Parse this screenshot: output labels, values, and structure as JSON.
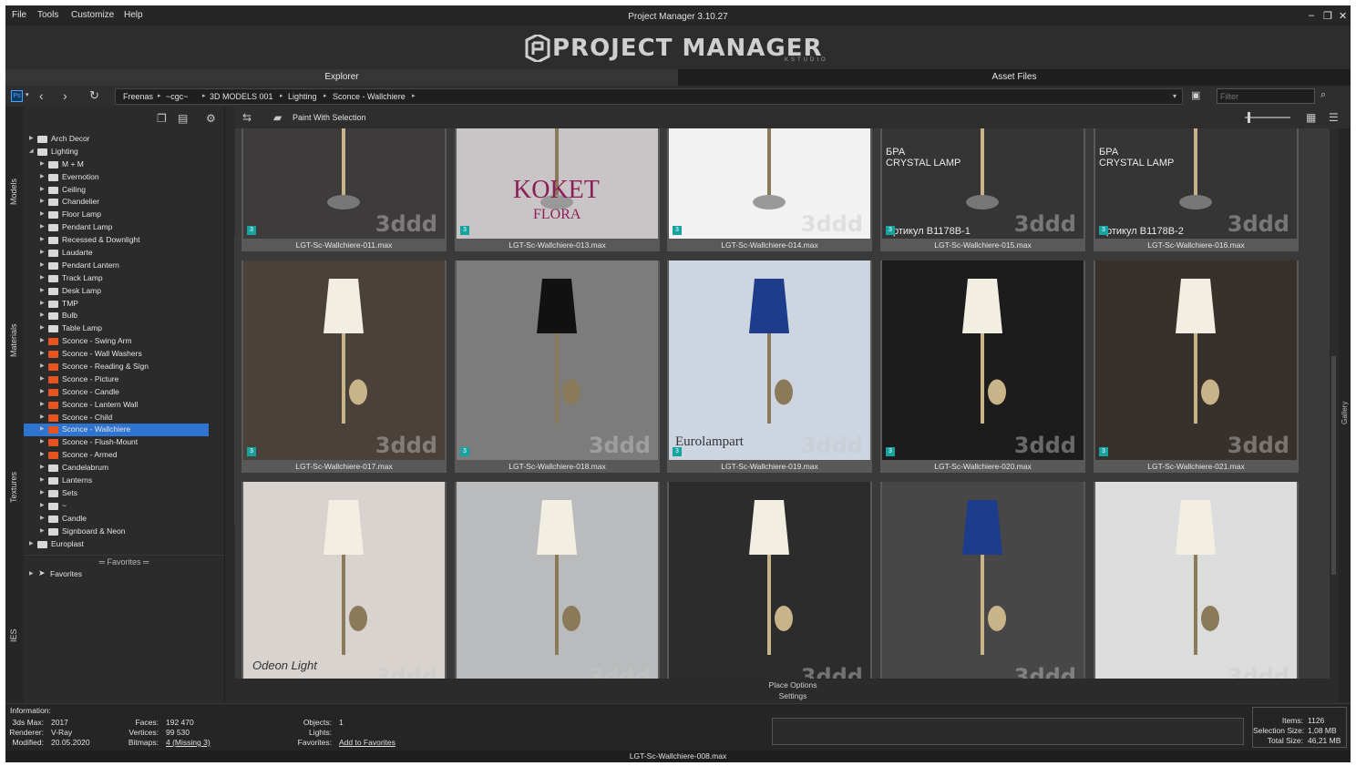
{
  "menu": [
    "File",
    "Tools",
    "Customize",
    "Help"
  ],
  "app_title": "Project Manager 3.10.27",
  "logo": {
    "text": "PROJECT MANAGER",
    "sub": "KSTUDIO"
  },
  "tabs": {
    "explorer": "Explorer",
    "assets": "Asset Files"
  },
  "breadcrumb": [
    "Freenas",
    "~cgc~",
    "3D MODELS 001",
    "Lighting",
    "Sconce - Wallchiere"
  ],
  "filter_placeholder": "Filter",
  "side_tabs": [
    "Models",
    "Materials",
    "Textures",
    "IES"
  ],
  "toolbar": {
    "paint_label": "Paint With Selection"
  },
  "tree": [
    {
      "label": "Arch Decor",
      "level": 0,
      "color": "gray"
    },
    {
      "label": "Lighting",
      "level": 0,
      "color": "gray",
      "open": true
    },
    {
      "label": "M + M",
      "level": 1,
      "color": "gray"
    },
    {
      "label": "Evernotion",
      "level": 1,
      "color": "gray"
    },
    {
      "label": "Ceiling",
      "level": 1,
      "color": "gray"
    },
    {
      "label": "Chandelier",
      "level": 1,
      "color": "gray"
    },
    {
      "label": "Floor Lamp",
      "level": 1,
      "color": "gray"
    },
    {
      "label": "Pendant Lamp",
      "level": 1,
      "color": "gray"
    },
    {
      "label": "Recessed & Downlight",
      "level": 1,
      "color": "gray"
    },
    {
      "label": "Laudarte",
      "level": 1,
      "color": "gray"
    },
    {
      "label": "Pendant Lantern",
      "level": 1,
      "color": "gray"
    },
    {
      "label": "Track Lamp",
      "level": 1,
      "color": "gray"
    },
    {
      "label": "Desk Lamp",
      "level": 1,
      "color": "gray"
    },
    {
      "label": "TMP",
      "level": 1,
      "color": "gray"
    },
    {
      "label": "Bulb",
      "level": 1,
      "color": "gray"
    },
    {
      "label": "Table Lamp",
      "level": 1,
      "color": "gray"
    },
    {
      "label": "Sconce - Swing Arm",
      "level": 1,
      "color": "orange"
    },
    {
      "label": "Sconce - Wall Washers",
      "level": 1,
      "color": "orange"
    },
    {
      "label": "Sconce - Reading & Sign",
      "level": 1,
      "color": "orange"
    },
    {
      "label": "Sconce - Picture",
      "level": 1,
      "color": "orange"
    },
    {
      "label": "Sconce - Candle",
      "level": 1,
      "color": "orange"
    },
    {
      "label": "Sconce - Lantern Wall",
      "level": 1,
      "color": "orange"
    },
    {
      "label": "Sconce - Child",
      "level": 1,
      "color": "orange"
    },
    {
      "label": "Sconce - Wallchiere",
      "level": 1,
      "color": "orange",
      "selected": true
    },
    {
      "label": "Sconce - Flush-Mount",
      "level": 1,
      "color": "orange"
    },
    {
      "label": "Sconce - Armed",
      "level": 1,
      "color": "orange"
    },
    {
      "label": "Candelabrum",
      "level": 1,
      "color": "gray"
    },
    {
      "label": "Lanterns",
      "level": 1,
      "color": "gray"
    },
    {
      "label": "Sets",
      "level": 1,
      "color": "gray"
    },
    {
      "label": "~",
      "level": 1,
      "color": "gray"
    },
    {
      "label": "Candle",
      "level": 1,
      "color": "gray"
    },
    {
      "label": "Signboard & Neon",
      "level": 1,
      "color": "gray"
    },
    {
      "label": "Europlast",
      "level": 0,
      "color": "gray"
    }
  ],
  "favorites": {
    "header": "Favorites",
    "item": "Favorites"
  },
  "gallery": [
    {
      "caption": "LGT-Sc-Wallchiere-011.max",
      "bg": "#3e3b3c",
      "text": ""
    },
    {
      "caption": "LGT-Sc-Wallchiere-013.max",
      "bg": "#c9c5c6",
      "text": "KOKET",
      "text2": "FLORA"
    },
    {
      "caption": "LGT-Sc-Wallchiere-014.max",
      "bg": "#f2f2f2",
      "text": ""
    },
    {
      "caption": "LGT-Sc-Wallchiere-015.max",
      "bg": "#353535",
      "text": "БРА",
      "text2": "CRYSTAL LAMP",
      "text3": "ртикул  B1178B-1"
    },
    {
      "caption": "LGT-Sc-Wallchiere-016.max",
      "bg": "#353535",
      "text": "БРА",
      "text2": "CRYSTAL LAMP",
      "text3": "ртикул  B1178B-2"
    },
    {
      "caption": "LGT-Sc-Wallchiere-017.max",
      "bg": "#4a413a",
      "text": ""
    },
    {
      "caption": "LGT-Sc-Wallchiere-018.max",
      "bg": "#7c7c7c",
      "text": ""
    },
    {
      "caption": "LGT-Sc-Wallchiere-019.max",
      "bg": "#cdd5e0",
      "text": "Eurolampart"
    },
    {
      "caption": "LGT-Sc-Wallchiere-020.max",
      "bg": "#1c1c1c",
      "text": ""
    },
    {
      "caption": "LGT-Sc-Wallchiere-021.max",
      "bg": "#38312b",
      "text": ""
    },
    {
      "caption": "",
      "bg": "#d8d3ce",
      "text": "Odeon Light"
    },
    {
      "caption": "",
      "bg": "#b9bbbc",
      "text": ""
    },
    {
      "caption": "",
      "bg": "#2c2c2c",
      "text": ""
    },
    {
      "caption": "",
      "bg": "#474747",
      "text": ""
    },
    {
      "caption": "",
      "bg": "#dcdcdc",
      "text": ""
    }
  ],
  "watermark": "3ddd",
  "badge": "3",
  "place_options": "Place Options",
  "settings": "Settings",
  "info": {
    "header": "Information:",
    "max_label": "3ds Max:",
    "max_value": "2017",
    "renderer_label": "Renderer:",
    "renderer_value": "V-Ray",
    "modified_label": "Modified:",
    "modified_value": "20.05.2020",
    "faces_label": "Faces:",
    "faces_value": "192 470",
    "vertices_label": "Vertices:",
    "vertices_value": "99 530",
    "bitmaps_label": "Bitmaps:",
    "bitmaps_value": "4 (Missing 3)",
    "objects_label": "Objects:",
    "objects_value": "1",
    "lights_label": "Lights:",
    "lights_value": "",
    "favorites_label": "Favorites:",
    "favorites_value": "Add to Favorites"
  },
  "stats": {
    "items_label": "Items:",
    "items_value": "1126",
    "selection_label": "Selection Size:",
    "selection_value": "1,08 MB",
    "total_label": "Total Size:",
    "total_value": "46,21 MB"
  },
  "status": "LGT-Sc-Wallchiere-008.max",
  "gallery_side_label": "Gallery"
}
